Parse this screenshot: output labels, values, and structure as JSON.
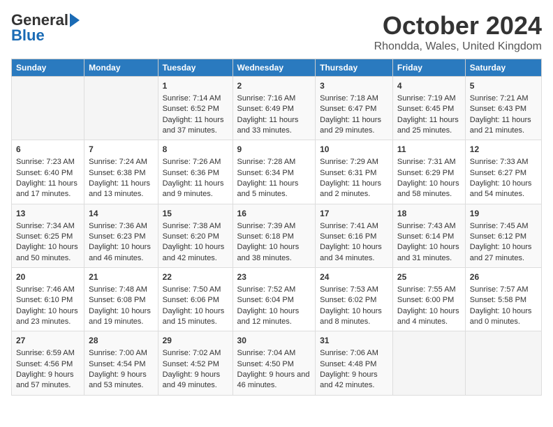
{
  "header": {
    "logo_general": "General",
    "logo_blue": "Blue",
    "month": "October 2024",
    "location": "Rhondda, Wales, United Kingdom"
  },
  "days_of_week": [
    "Sunday",
    "Monday",
    "Tuesday",
    "Wednesday",
    "Thursday",
    "Friday",
    "Saturday"
  ],
  "weeks": [
    [
      {
        "day": "",
        "info": ""
      },
      {
        "day": "",
        "info": ""
      },
      {
        "day": "1",
        "info": "Sunrise: 7:14 AM\nSunset: 6:52 PM\nDaylight: 11 hours and 37 minutes."
      },
      {
        "day": "2",
        "info": "Sunrise: 7:16 AM\nSunset: 6:49 PM\nDaylight: 11 hours and 33 minutes."
      },
      {
        "day": "3",
        "info": "Sunrise: 7:18 AM\nSunset: 6:47 PM\nDaylight: 11 hours and 29 minutes."
      },
      {
        "day": "4",
        "info": "Sunrise: 7:19 AM\nSunset: 6:45 PM\nDaylight: 11 hours and 25 minutes."
      },
      {
        "day": "5",
        "info": "Sunrise: 7:21 AM\nSunset: 6:43 PM\nDaylight: 11 hours and 21 minutes."
      }
    ],
    [
      {
        "day": "6",
        "info": "Sunrise: 7:23 AM\nSunset: 6:40 PM\nDaylight: 11 hours and 17 minutes."
      },
      {
        "day": "7",
        "info": "Sunrise: 7:24 AM\nSunset: 6:38 PM\nDaylight: 11 hours and 13 minutes."
      },
      {
        "day": "8",
        "info": "Sunrise: 7:26 AM\nSunset: 6:36 PM\nDaylight: 11 hours and 9 minutes."
      },
      {
        "day": "9",
        "info": "Sunrise: 7:28 AM\nSunset: 6:34 PM\nDaylight: 11 hours and 5 minutes."
      },
      {
        "day": "10",
        "info": "Sunrise: 7:29 AM\nSunset: 6:31 PM\nDaylight: 11 hours and 2 minutes."
      },
      {
        "day": "11",
        "info": "Sunrise: 7:31 AM\nSunset: 6:29 PM\nDaylight: 10 hours and 58 minutes."
      },
      {
        "day": "12",
        "info": "Sunrise: 7:33 AM\nSunset: 6:27 PM\nDaylight: 10 hours and 54 minutes."
      }
    ],
    [
      {
        "day": "13",
        "info": "Sunrise: 7:34 AM\nSunset: 6:25 PM\nDaylight: 10 hours and 50 minutes."
      },
      {
        "day": "14",
        "info": "Sunrise: 7:36 AM\nSunset: 6:23 PM\nDaylight: 10 hours and 46 minutes."
      },
      {
        "day": "15",
        "info": "Sunrise: 7:38 AM\nSunset: 6:20 PM\nDaylight: 10 hours and 42 minutes."
      },
      {
        "day": "16",
        "info": "Sunrise: 7:39 AM\nSunset: 6:18 PM\nDaylight: 10 hours and 38 minutes."
      },
      {
        "day": "17",
        "info": "Sunrise: 7:41 AM\nSunset: 6:16 PM\nDaylight: 10 hours and 34 minutes."
      },
      {
        "day": "18",
        "info": "Sunrise: 7:43 AM\nSunset: 6:14 PM\nDaylight: 10 hours and 31 minutes."
      },
      {
        "day": "19",
        "info": "Sunrise: 7:45 AM\nSunset: 6:12 PM\nDaylight: 10 hours and 27 minutes."
      }
    ],
    [
      {
        "day": "20",
        "info": "Sunrise: 7:46 AM\nSunset: 6:10 PM\nDaylight: 10 hours and 23 minutes."
      },
      {
        "day": "21",
        "info": "Sunrise: 7:48 AM\nSunset: 6:08 PM\nDaylight: 10 hours and 19 minutes."
      },
      {
        "day": "22",
        "info": "Sunrise: 7:50 AM\nSunset: 6:06 PM\nDaylight: 10 hours and 15 minutes."
      },
      {
        "day": "23",
        "info": "Sunrise: 7:52 AM\nSunset: 6:04 PM\nDaylight: 10 hours and 12 minutes."
      },
      {
        "day": "24",
        "info": "Sunrise: 7:53 AM\nSunset: 6:02 PM\nDaylight: 10 hours and 8 minutes."
      },
      {
        "day": "25",
        "info": "Sunrise: 7:55 AM\nSunset: 6:00 PM\nDaylight: 10 hours and 4 minutes."
      },
      {
        "day": "26",
        "info": "Sunrise: 7:57 AM\nSunset: 5:58 PM\nDaylight: 10 hours and 0 minutes."
      }
    ],
    [
      {
        "day": "27",
        "info": "Sunrise: 6:59 AM\nSunset: 4:56 PM\nDaylight: 9 hours and 57 minutes."
      },
      {
        "day": "28",
        "info": "Sunrise: 7:00 AM\nSunset: 4:54 PM\nDaylight: 9 hours and 53 minutes."
      },
      {
        "day": "29",
        "info": "Sunrise: 7:02 AM\nSunset: 4:52 PM\nDaylight: 9 hours and 49 minutes."
      },
      {
        "day": "30",
        "info": "Sunrise: 7:04 AM\nSunset: 4:50 PM\nDaylight: 9 hours and 46 minutes."
      },
      {
        "day": "31",
        "info": "Sunrise: 7:06 AM\nSunset: 4:48 PM\nDaylight: 9 hours and 42 minutes."
      },
      {
        "day": "",
        "info": ""
      },
      {
        "day": "",
        "info": ""
      }
    ]
  ]
}
